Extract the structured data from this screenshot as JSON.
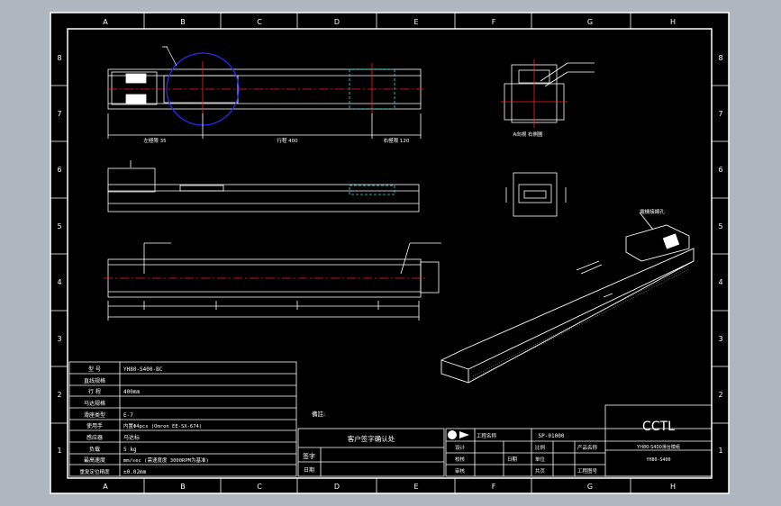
{
  "zone_columns": [
    "A",
    "B",
    "C",
    "D",
    "E",
    "F",
    "G",
    "H"
  ],
  "zone_rows": [
    "8",
    "7",
    "6",
    "5",
    "4",
    "3",
    "2",
    "1"
  ],
  "top_view_dims": {
    "left": "左極限 35",
    "center": "行程 400",
    "right": "右極限 120"
  },
  "end_view_label": "A向視 右側圖",
  "iso_label": "電機接線孔",
  "note_label": "備註:",
  "spec_table": [
    {
      "key": "型 号",
      "value": "YH80-S400-BC"
    },
    {
      "key": "直线规格",
      "value": ""
    },
    {
      "key": "行 程",
      "value": "400mm"
    },
    {
      "key": "马达规格",
      "value": ""
    },
    {
      "key": "滑座类型",
      "value": "E-7"
    },
    {
      "key": "使用手",
      "value": "内置Φ4pcs (Omron EE-SX-674)"
    },
    {
      "key": "感应器",
      "value": "马达标"
    },
    {
      "key": "负载",
      "value": "5 kg"
    },
    {
      "key": "最高速度",
      "value": "mm/sec (需速度度 3000RPM为基准)"
    },
    {
      "key": "重复定位精度",
      "value": "±0.02mm"
    }
  ],
  "confirm_title": "客户签字确认处",
  "sign_label": "签字",
  "date_label": "日期",
  "title_block": {
    "company": "CCTL",
    "project_label": "工程名称",
    "project_value": "SP-01000",
    "drawing_name": "YH80-S400滑台模组",
    "drawing_no": "YH80-S400",
    "rows": [
      {
        "c1": "设计",
        "c2": "",
        "c3": "",
        "c4": "比例",
        "c5": "",
        "c6": "产品名称"
      },
      {
        "c1": "校核",
        "c2": "",
        "c3": "日期",
        "c4": "单位",
        "c5": "",
        "c6": ""
      },
      {
        "c1": "审核",
        "c2": "",
        "c3": "",
        "c4": "共页",
        "c5": "",
        "c6": "工程图号"
      }
    ]
  }
}
